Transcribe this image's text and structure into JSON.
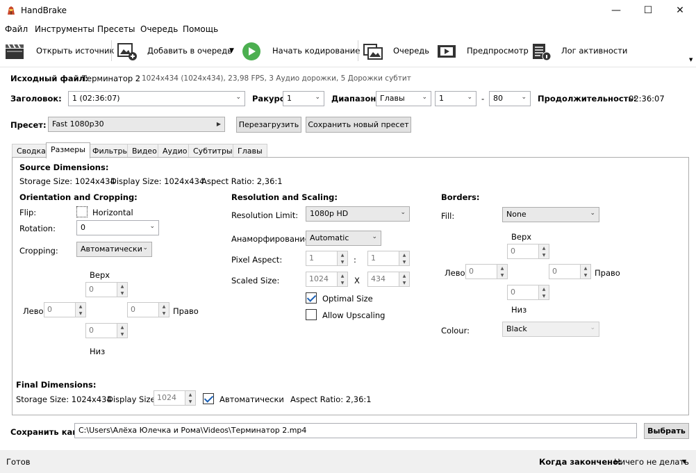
{
  "window": {
    "title": "HandBrake",
    "minimize": "—",
    "maximize": "☐",
    "close": "✕"
  },
  "menu": [
    "Файл",
    "Инструменты",
    "Пресеты",
    "Очередь",
    "Помощь"
  ],
  "toolbar": {
    "open_source": "Открыть источник",
    "add_queue": "Добавить в очередь",
    "start": "Начать кодирование",
    "queue": "Очередь",
    "preview": "Предпросмотр",
    "log": "Лог активности"
  },
  "source": {
    "label": "Исходный файл:",
    "name": "Терминатор 2",
    "info": "1024x434 (1024x434), 23,98 FPS, 3 Аудио дорожки, 5 Дорожки субтит"
  },
  "title_row": {
    "title_label": "Заголовок:",
    "title_value": "1 (02:36:07)",
    "angle_label": "Ракурс:",
    "angle_value": "1",
    "range_label": "Диапазон:",
    "range_type": "Главы",
    "range_start": "1",
    "range_dash": "-",
    "range_end": "80",
    "duration_label": "Продолжительность:",
    "duration_value": "02:36:07"
  },
  "preset": {
    "label": "Пресет:",
    "value": "Fast 1080p30",
    "reload": "Перезагрузить",
    "save_new": "Сохранить новый пресет"
  },
  "tabs": [
    "Сводка",
    "Размеры",
    "Фильтры",
    "Видео",
    "Аудио",
    "Субтитры",
    "Главы"
  ],
  "dimensions": {
    "source_title": "Source Dimensions:",
    "storage": "Storage Size: 1024x434",
    "display": "Display Size: 1024x434",
    "aspect": "Aspect Ratio: 2,36:1",
    "orient_title": "Orientation and Cropping:",
    "flip_label": "Flip:",
    "flip_option": "Horizontal",
    "rotation_label": "Rotation:",
    "rotation_value": "0",
    "cropping_label": "Cropping:",
    "cropping_value": "Автоматически",
    "crop": {
      "top_label": "Верх",
      "bottom_label": "Низ",
      "left_label": "Лево",
      "right_label": "Право",
      "top": "0",
      "bottom": "0",
      "left": "0",
      "right": "0"
    },
    "res_title": "Resolution and Scaling:",
    "res_limit_label": "Resolution Limit:",
    "res_limit_value": "1080p HD",
    "anamorphic_label": "Анаморфирование:",
    "anamorphic_value": "Automatic",
    "pixel_aspect_label": "Pixel Aspect:",
    "pixel_w": "1",
    "pixel_colon": ":",
    "pixel_h": "1",
    "scaled_label": "Scaled Size:",
    "scaled_w": "1024",
    "scaled_x": "X",
    "scaled_h": "434",
    "optimal": "Optimal Size",
    "upscaling": "Allow Upscaling",
    "borders_title": "Borders:",
    "fill_label": "Fill:",
    "fill_value": "None",
    "b_top_label": "Верх",
    "b_bottom_label": "Низ",
    "b_left_label": "Лево",
    "b_right_label": "Право",
    "b_top": "0",
    "b_bottom": "0",
    "b_left": "0",
    "b_right": "0",
    "colour_label": "Colour:",
    "colour_value": "Black",
    "final_title": "Final Dimensions:",
    "final_storage": "Storage Size: 1024x434",
    "final_display_label": "Display Size:",
    "final_display_value": "1024",
    "final_auto": "Автоматически",
    "final_aspect": "Aspect Ratio: 2,36:1"
  },
  "save": {
    "label": "Сохранить как:",
    "path": "C:\\Users\\Алёха Юлечка и Рома\\Videos\\Терминатор 2.mp4",
    "browse": "Выбрать"
  },
  "status": {
    "text": "Готов",
    "when_done_label": "Когда закончено:",
    "when_done_value": "Ничего не делать"
  }
}
